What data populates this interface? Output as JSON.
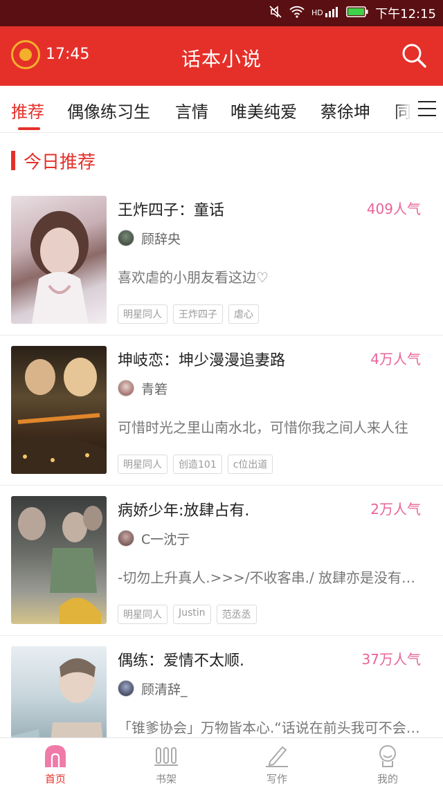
{
  "status_bar": {
    "time": "下午12:15"
  },
  "header": {
    "timer": "17:45",
    "title": "话本小说"
  },
  "tabs": [
    "推荐",
    "偶像练习生",
    "言情",
    "唯美纯爱",
    "蔡徐坤",
    "同人"
  ],
  "section_title": "今日推荐",
  "books": [
    {
      "title": "王炸四子：童话",
      "popularity": "409人气",
      "author": "顾辞央",
      "desc": "喜欢虐的小朋友看这边♡",
      "tags": [
        "明星同人",
        "王炸四子",
        "虐心"
      ]
    },
    {
      "title": "坤岐恋：坤少漫漫追妻路",
      "popularity": "4万人气",
      "author": "青箬",
      "desc": "可惜时光之里山南水北，可惜你我之间人来人往",
      "tags": [
        "明星同人",
        "创造101",
        "c位出道"
      ]
    },
    {
      "title": "病娇少年:放肆占有.",
      "popularity": "2万人气",
      "author": "C一沈亍",
      "desc": "-切勿上升真人.>>>/不收客串./ 放肆亦是没有了界限",
      "tags": [
        "明星同人",
        "Justin",
        "范丞丞"
      ]
    },
    {
      "title": "偶练：爱情不太顺.",
      "popularity": "37万人气",
      "author": "顾清辞_",
      "desc": "「锥爹协会」万物皆本心.“话说在前头我可不会手下留情",
      "tags": []
    }
  ],
  "bottom_nav": [
    {
      "label": "首页",
      "icon": "home-icon",
      "active": true
    },
    {
      "label": "书架",
      "icon": "bookshelf-icon",
      "active": false
    },
    {
      "label": "写作",
      "icon": "pen-icon",
      "active": false
    },
    {
      "label": "我的",
      "icon": "profile-icon",
      "active": false
    }
  ],
  "colors": {
    "brand": "#e5302a",
    "popularity": "#e86398",
    "status_bar": "#5a0f12"
  }
}
